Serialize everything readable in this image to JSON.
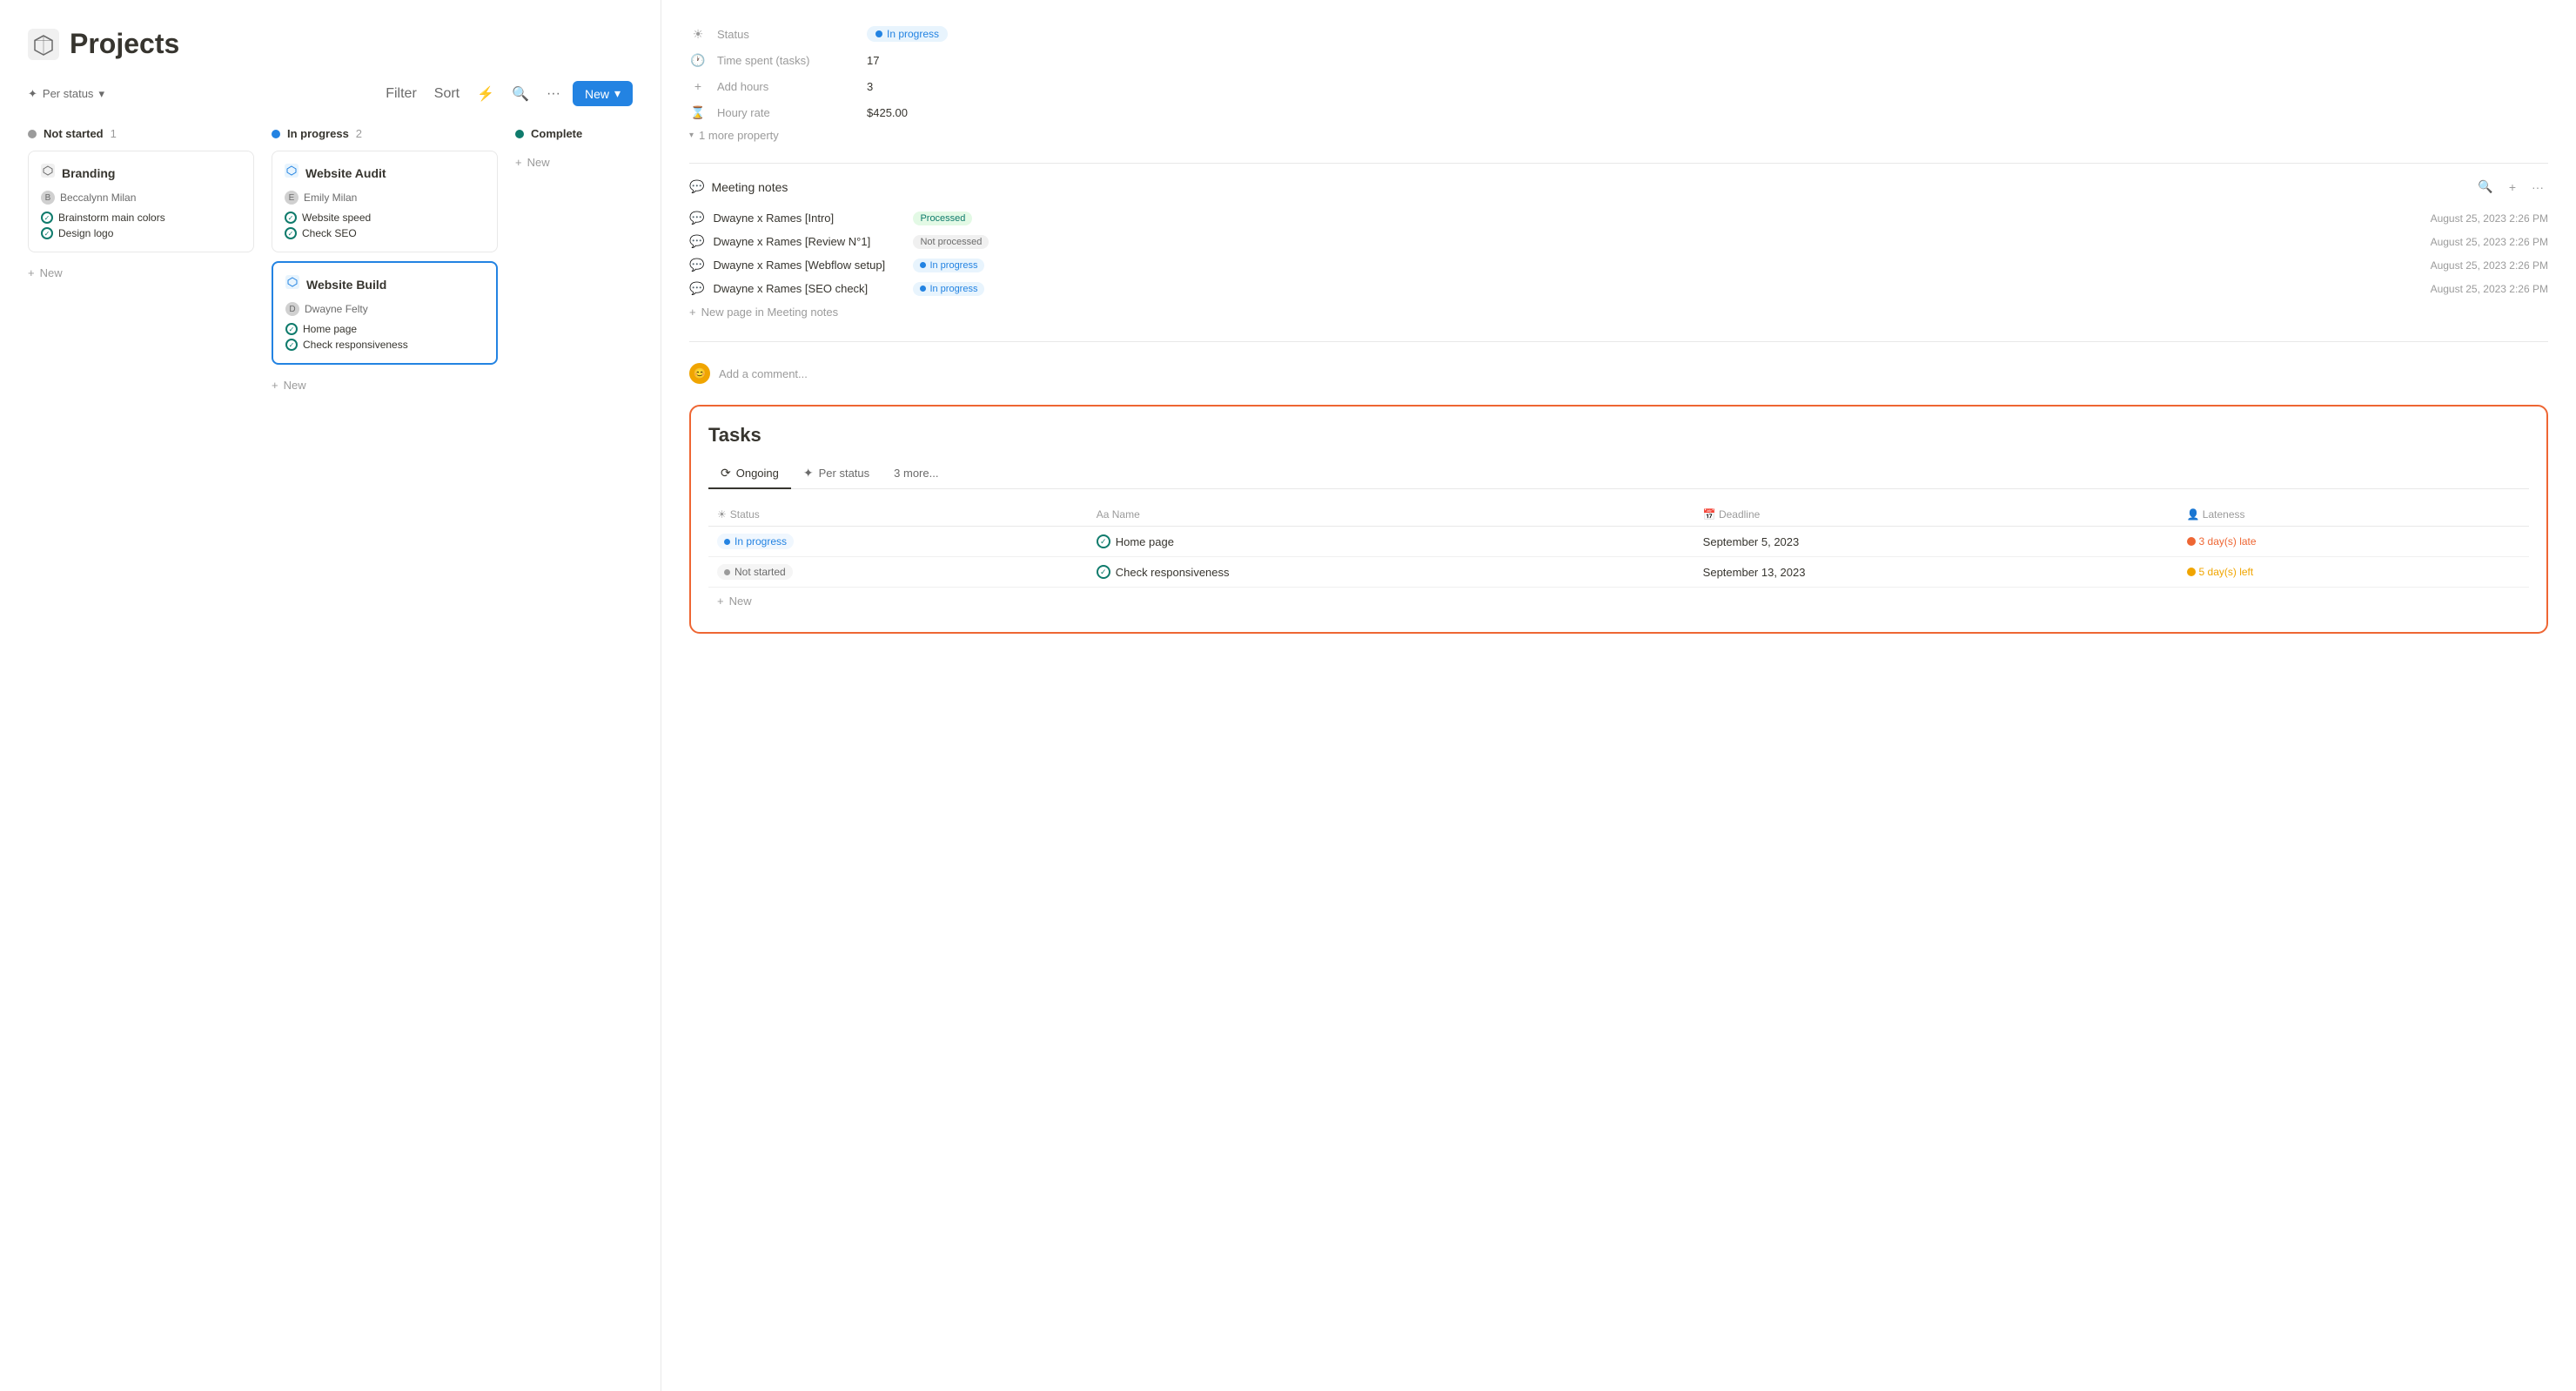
{
  "page": {
    "title": "Projects",
    "icon": "cube-icon"
  },
  "toolbar": {
    "group_by": "Per status",
    "filter_label": "Filter",
    "sort_label": "Sort",
    "new_label": "New"
  },
  "columns": [
    {
      "id": "not-started",
      "label": "Not started",
      "count": 1,
      "dot_color": "gray",
      "cards": [
        {
          "id": "branding",
          "title": "Branding",
          "user": "Beccalynn Milan",
          "tasks": [
            "Brainstorm main colors",
            "Design logo"
          ]
        }
      ]
    },
    {
      "id": "in-progress",
      "label": "In progress",
      "count": 2,
      "dot_color": "blue",
      "cards": [
        {
          "id": "website-audit",
          "title": "Website Audit",
          "user": "Emily Milan",
          "tasks": [
            "Website speed",
            "Check SEO"
          ],
          "selected": false
        },
        {
          "id": "website-build",
          "title": "Website Build",
          "user": "Dwayne Felty",
          "tasks": [
            "Home page",
            "Check responsiveness"
          ],
          "selected": true
        }
      ]
    },
    {
      "id": "complete",
      "label": "Complete",
      "count": null,
      "dot_color": "green",
      "cards": []
    }
  ],
  "add_new_labels": {
    "not_started": "+ New",
    "in_progress": "+ New",
    "new_label": "New"
  },
  "right_panel": {
    "properties": {
      "status_label": "Status",
      "status_value": "In progress",
      "time_spent_label": "Time spent (tasks)",
      "time_spent_value": "17",
      "add_hours_label": "Add hours",
      "add_hours_value": "3",
      "hourly_rate_label": "Houry rate",
      "hourly_rate_value": "$425.00",
      "more_property": "1 more property"
    },
    "meeting_notes": {
      "title": "Meeting notes",
      "entries": [
        {
          "title": "Dwayne x Rames [Intro]",
          "badge": "Processed",
          "badge_type": "processed",
          "date": "August 25, 2023 2:26 PM"
        },
        {
          "title": "Dwayne x Rames [Review N°1]",
          "badge": "Not processed",
          "badge_type": "not-processed",
          "date": "August 25, 2023 2:26 PM"
        },
        {
          "title": "Dwayne x Rames [Webflow setup]",
          "badge": "In progress",
          "badge_type": "in-progress",
          "date": "August 25, 2023 2:26 PM"
        },
        {
          "title": "Dwayne x Rames [SEO check]",
          "badge": "In progress",
          "badge_type": "in-progress",
          "date": "August 25, 2023 2:26 PM"
        }
      ],
      "new_page_label": "New page in Meeting notes"
    },
    "comment_placeholder": "Add a comment...",
    "tasks": {
      "title": "Tasks",
      "tabs": [
        {
          "label": "Ongoing",
          "icon": "⟳",
          "active": true
        },
        {
          "label": "Per status",
          "icon": "✦",
          "active": false
        },
        {
          "label": "3 more...",
          "icon": "",
          "active": false
        }
      ],
      "columns": {
        "status": "Status",
        "name": "Name",
        "deadline": "Deadline",
        "lateness": "Lateness"
      },
      "rows": [
        {
          "status": "In progress",
          "status_type": "in-progress",
          "name": "Home page",
          "deadline": "September 5, 2023",
          "lateness": "3 day(s) late",
          "lateness_type": "late"
        },
        {
          "status": "Not started",
          "status_type": "not-started",
          "name": "Check responsiveness",
          "deadline": "September 13, 2023",
          "lateness": "5 day(s) left",
          "lateness_type": "left"
        }
      ],
      "add_label": "New"
    }
  }
}
